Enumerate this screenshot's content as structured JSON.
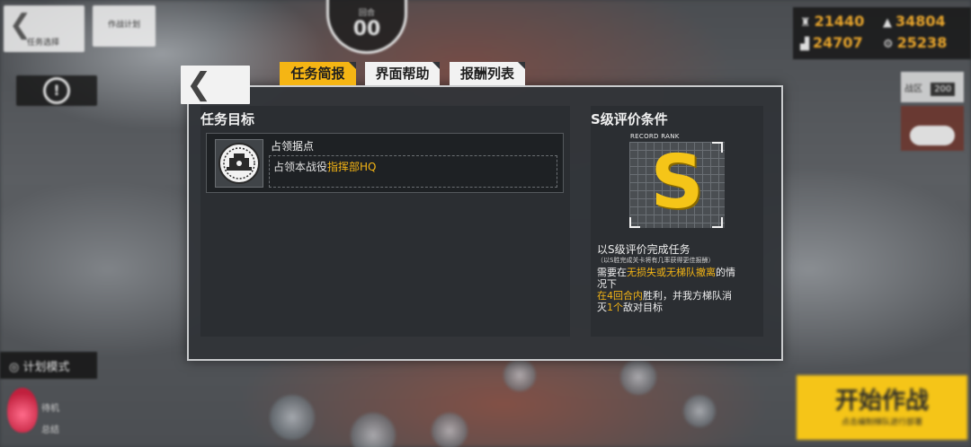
{
  "background_hud": {
    "back_label": "任务选择",
    "plan_label": "作战计划",
    "turn_label": "回合",
    "turn_value": "00",
    "resources": [
      {
        "icon": "manpower-icon",
        "value": "21440"
      },
      {
        "icon": "ammo-icon",
        "value": "34804"
      },
      {
        "icon": "ration-icon",
        "value": "24707"
      },
      {
        "icon": "parts-icon",
        "value": "25238"
      }
    ],
    "right_panel_label": "战区",
    "right_panel_value": "200",
    "mode_label": "计划模式",
    "status_labels": [
      "待机",
      "总结"
    ],
    "start_label": "开始作战",
    "start_sublabel": "点击编制梯队进行部署"
  },
  "modal": {
    "tabs": [
      {
        "label": "任务简报",
        "active": true
      },
      {
        "label": "界面帮助",
        "active": false
      },
      {
        "label": "报酬列表",
        "active": false
      }
    ],
    "objectives": {
      "title": "任务目标",
      "items": [
        {
          "name": "占领据点",
          "desc_prefix": "占领本战役",
          "desc_highlight": "指挥部HQ"
        }
      ]
    },
    "rank": {
      "title": "S级评价条件",
      "record_label": "RECORD RANK",
      "rank_letter": "S",
      "line1": "以S级评价完成任务",
      "note": "（以S胜完成关卡将有几率获得更佳报酬）",
      "line2_prefix": "需要在",
      "line2_highlight": "无损失或无梯队撤离",
      "line2_suffix": "的情",
      "line3": "况下",
      "line4_highlight": "在4回合内",
      "line4_suffix": "胜利，并我方梯队消",
      "line5_prefix": "灭",
      "line5_highlight": "1个",
      "line5_suffix": "敌对目标"
    }
  },
  "colors": {
    "accent": "#f5b514",
    "panel": "#2b2e32",
    "modal_bg": "#303438"
  }
}
